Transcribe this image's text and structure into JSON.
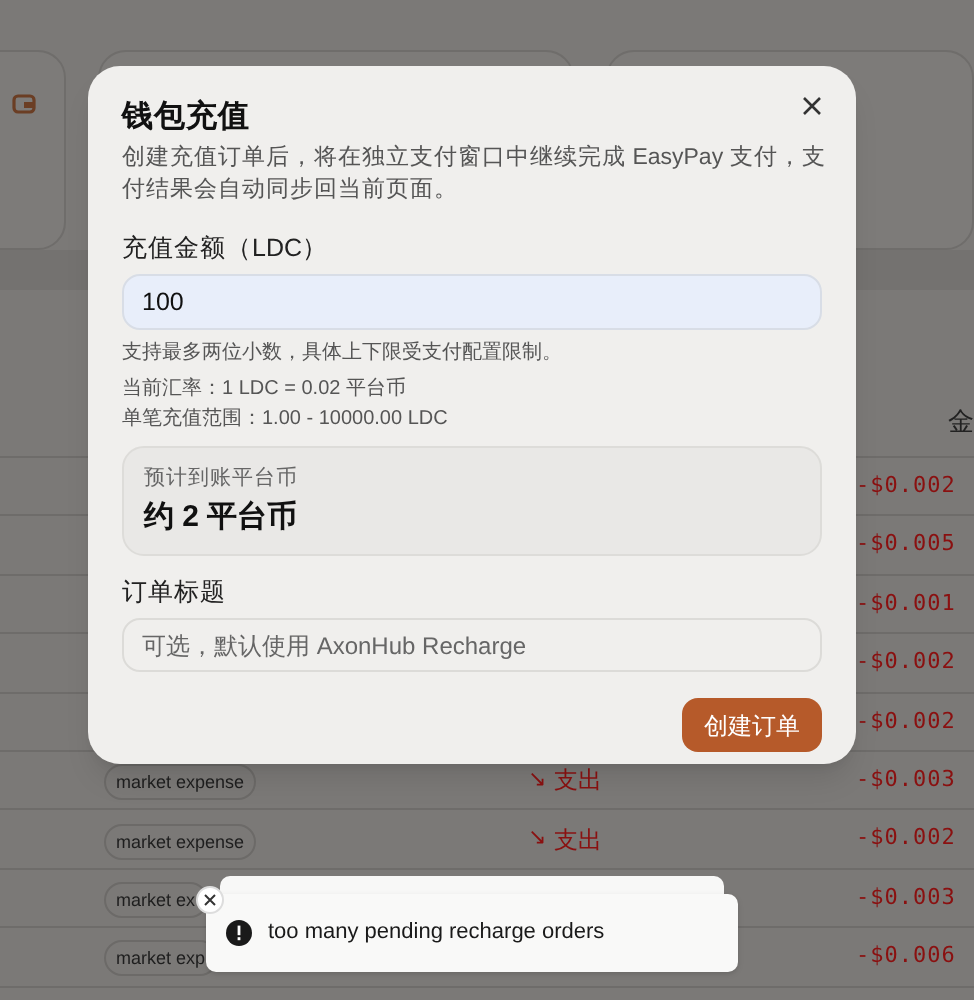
{
  "table": {
    "columns": [
      {
        "label": "金"
      }
    ],
    "rows": [
      {
        "amount": "-$0.002"
      },
      {
        "amount": "-$0.005"
      },
      {
        "amount": "-$0.001"
      },
      {
        "amount": "-$0.002"
      },
      {
        "amount": "-$0.002"
      },
      {
        "tag": "market expense",
        "arrow": "↘",
        "type": "支出",
        "amount": "-$0.003"
      },
      {
        "tag": "market expense",
        "arrow": "↘",
        "type": "支出",
        "amount": "-$0.002"
      },
      {
        "tag": "market ex",
        "amount": "-$0.003"
      },
      {
        "tag": "market exp",
        "amount": "-$0.006"
      }
    ]
  },
  "dialog": {
    "title": "钱包充值",
    "description": "创建充值订单后，将在独立支付窗口中继续完成 EasyPay 支付，支付结果会自动同步回当前页面。",
    "amount_label": "充值金额（LDC）",
    "amount_value": "100",
    "hints": [
      "支持最多两位小数，具体上下限受支付配置限制。",
      "当前汇率：1 LDC = 0.02 平台币",
      "单笔充值范围：1.00 - 10000.00 LDC"
    ],
    "estimate_label": "预计到账平台币",
    "estimate_value": "约 2 平台币",
    "title_label": "订单标题",
    "title_placeholder": "可选，默认使用 AxonHub Recharge",
    "submit": "创建订单"
  },
  "toast": {
    "message": "too many pending recharge orders"
  }
}
